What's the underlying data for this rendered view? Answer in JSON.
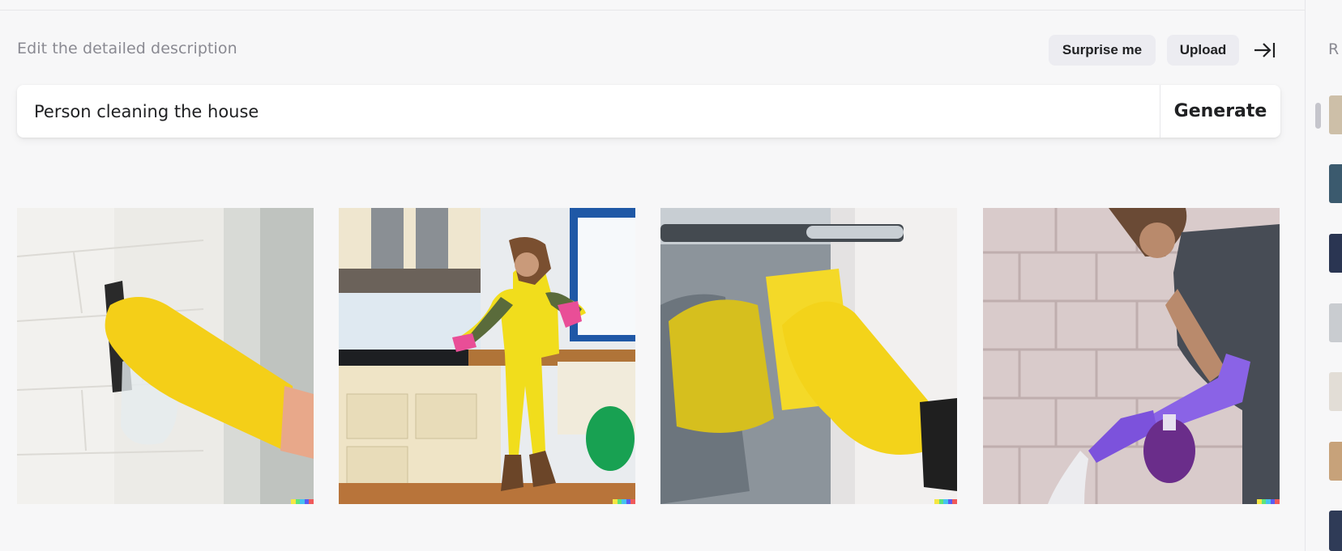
{
  "header": {
    "label": "Edit the detailed description",
    "surprise_label": "Surprise me",
    "upload_label": "Upload"
  },
  "prompt": {
    "value": "Person cleaning the house",
    "generate_label": "Generate"
  },
  "results": [
    {
      "name": "gloved hand scrubbing white brick wall with sponge"
    },
    {
      "name": "woman in yellow overalls cleaning kitchen counter"
    },
    {
      "name": "yellow gloved hand wiping appliance with sponge"
    },
    {
      "name": "woman spraying cleaner with purple gloves"
    }
  ],
  "sidebar": {
    "title": "R"
  },
  "colors": {
    "background": "#f7f7f8",
    "button_bg": "#ececf1",
    "muted_text": "#8a8a92",
    "signature": [
      "#f5e642",
      "#5ee37a",
      "#46c3f0",
      "#5b5cf2",
      "#f05a5a"
    ]
  }
}
